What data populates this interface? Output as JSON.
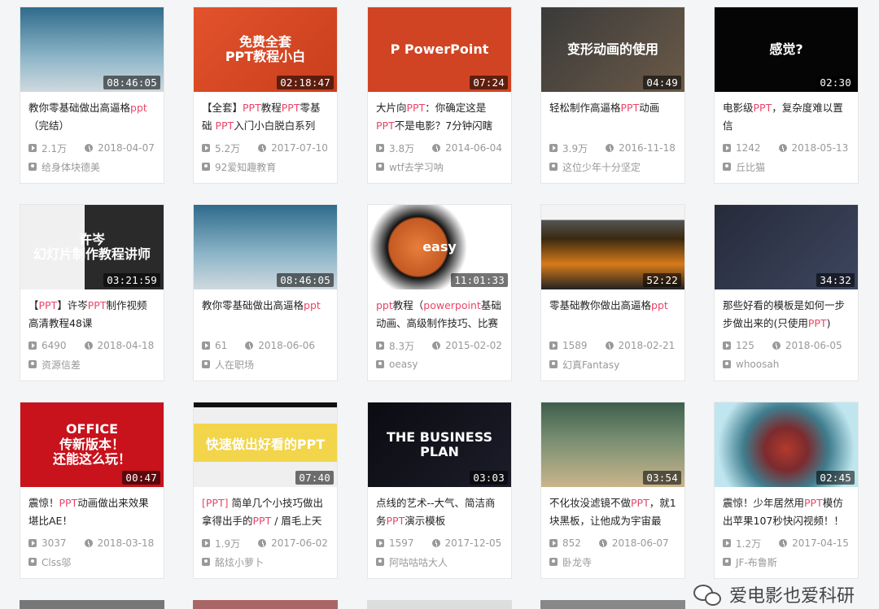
{
  "colors": {
    "highlight": "#e8466a",
    "meta": "#999999"
  },
  "icons": {
    "views": "play-icon",
    "date": "clock-icon",
    "author": "user-icon"
  },
  "videos": [
    {
      "thumb_text": "",
      "thumb_bg": "linear-gradient(180deg,#2f6b8c,#8fb7c9 60%,#cfd9de)",
      "duration": "08:46:05",
      "title": [
        {
          "t": "教你零基础做出高逼格"
        },
        {
          "t": "ppt",
          "hl": true
        },
        {
          "t": "（完结）"
        }
      ],
      "views": "2.1万",
      "date": "2018-04-07",
      "author": "给身体块德美"
    },
    {
      "thumb_text": "免费全套\nPPT教程小白",
      "thumb_bg": "linear-gradient(135deg,#e2522c,#c93e1c)",
      "duration": "02:18:47",
      "title": [
        {
          "t": "【全套】"
        },
        {
          "t": "PPT",
          "hl": true
        },
        {
          "t": "教程"
        },
        {
          "t": "PPT",
          "hl": true
        },
        {
          "t": "零基础 "
        },
        {
          "t": "PPT",
          "hl": true
        },
        {
          "t": "入门小白脱白系列"
        }
      ],
      "views": "5.2万",
      "date": "2017-07-10",
      "author": "92爱知趣教育"
    },
    {
      "thumb_text": "P  PowerPoint",
      "thumb_bg": "#d04423",
      "duration": "07:24",
      "title": [
        {
          "t": "大片向"
        },
        {
          "t": "PPT",
          "hl": true
        },
        {
          "t": "：你确定这是"
        },
        {
          "t": "PPT",
          "hl": true
        },
        {
          "t": "不是电影？7分钟闪瞎"
        }
      ],
      "views": "3.8万",
      "date": "2014-06-04",
      "author": "wtf去学习呐"
    },
    {
      "thumb_text": "变形动画的使用",
      "thumb_bg": "linear-gradient(135deg,#3a3a3a,#6b5a48)",
      "duration": "04:49",
      "title": [
        {
          "t": "轻松制作高逼格"
        },
        {
          "t": "PPT",
          "hl": true
        },
        {
          "t": "动画"
        }
      ],
      "views": "3.9万",
      "date": "2016-11-18",
      "author": "这位少年十分坚定"
    },
    {
      "thumb_text": "感觉?",
      "thumb_bg": "#050505",
      "duration": "02:30",
      "title": [
        {
          "t": "电影级"
        },
        {
          "t": "PPT",
          "hl": true
        },
        {
          "t": "，复杂度难以置信"
        }
      ],
      "views": "1242",
      "date": "2018-05-13",
      "author": "丘比猫"
    },
    {
      "thumb_text": "许岑\n幻灯片制作教程讲师",
      "thumb_bg": "linear-gradient(90deg,#f0f0f0 45%,#2a2a2a 45%)",
      "duration": "03:21:59",
      "title": [
        {
          "t": "【"
        },
        {
          "t": "PPT",
          "hl": true
        },
        {
          "t": "】许岑"
        },
        {
          "t": "PPT",
          "hl": true
        },
        {
          "t": "制作视频高清教程48课"
        }
      ],
      "views": "6490",
      "date": "2018-04-18",
      "author": "资源信差"
    },
    {
      "thumb_text": "",
      "thumb_bg": "linear-gradient(180deg,#2f6b8c,#8fb7c9 60%,#cfd9de)",
      "duration": "08:46:05",
      "title": [
        {
          "t": "教你零基础做出高逼格"
        },
        {
          "t": "ppt",
          "hl": true
        }
      ],
      "views": "61",
      "date": "2018-06-06",
      "author": "人在职场"
    },
    {
      "thumb_text": "easy",
      "thumb_bg": "radial-gradient(circle at 35% 50%,#e87e3c 0,#c55a23 28%,#111 30%,#fff 48%)",
      "duration": "11:01:33",
      "title": [
        {
          "t": "ppt",
          "hl": true
        },
        {
          "t": "教程（"
        },
        {
          "t": "powerpoint",
          "hl": true
        },
        {
          "t": "基础动画、高级制作技巧、比赛作"
        }
      ],
      "views": "8.3万",
      "date": "2015-02-02",
      "author": "oeasy"
    },
    {
      "thumb_text": "",
      "thumb_bg": "linear-gradient(180deg,#f3f3f3 18%,#555 18%,#3a2a10 40%,#d77a1a 70%,#222)",
      "duration": "52:22",
      "title": [
        {
          "t": "零基础教你做出高逼格"
        },
        {
          "t": "ppt",
          "hl": true
        }
      ],
      "views": "1589",
      "date": "2018-02-21",
      "author": "幻真Fantasy"
    },
    {
      "thumb_text": "",
      "thumb_bg": "linear-gradient(135deg,#262b3a,#3d4660)",
      "duration": "34:32",
      "title": [
        {
          "t": "那些好看的模板是如何一步步做出来的(只使用"
        },
        {
          "t": "PPT",
          "hl": true
        },
        {
          "t": ")"
        }
      ],
      "views": "125",
      "date": "2018-06-05",
      "author": "whoosah"
    },
    {
      "thumb_text": "OFFICE\n传新版本！\n还能这么玩！",
      "thumb_bg": "#c8121c",
      "duration": "00:47",
      "title": [
        {
          "t": "震惊！"
        },
        {
          "t": "PPT",
          "hl": true
        },
        {
          "t": "动画做出来效果堪比AE！"
        }
      ],
      "views": "3037",
      "date": "2018-03-18",
      "author": "Clss邬"
    },
    {
      "thumb_text": "快速做出好看的PPT",
      "thumb_bg": "linear-gradient(180deg,#111 6%,#efefef 6%,#efefef 25%,#f2d54a 25%,#f2d54a 70%,#efefef 70%)",
      "duration": "07:40",
      "title": [
        {
          "t": "[",
          "hl": true
        },
        {
          "t": "PPT",
          "hl": true
        },
        {
          "t": "]",
          "hl": true
        },
        {
          "t": " 简单几个小技巧做出拿得出手的"
        },
        {
          "t": "PPT",
          "hl": true
        },
        {
          "t": " / 眉毛上天"
        }
      ],
      "views": "1.9万",
      "date": "2017-06-02",
      "author": "酩炫小萝卜"
    },
    {
      "thumb_text": "THE BUSINESS  PLAN",
      "thumb_bg": "linear-gradient(135deg,#0b0b12,#1d1d2a)",
      "duration": "03:03",
      "title": [
        {
          "t": "点线的艺术--大气、简洁商务"
        },
        {
          "t": "PPT",
          "hl": true
        },
        {
          "t": "演示模板"
        }
      ],
      "views": "1597",
      "date": "2017-12-05",
      "author": "阿咕咕咕大人"
    },
    {
      "thumb_text": "",
      "thumb_bg": "linear-gradient(180deg,#3d5f4c,#7a8f72 45%,#c9b58c)",
      "duration": "03:54",
      "title": [
        {
          "t": "不化妆没滤镜不做"
        },
        {
          "t": "PPT",
          "hl": true
        },
        {
          "t": "，就1块黑板，让他成为宇宙最"
        }
      ],
      "views": "852",
      "date": "2018-06-07",
      "author": "卧龙寺"
    },
    {
      "thumb_text": "",
      "thumb_bg": "radial-gradient(circle at 50% 55%,#b23a2c 0,#7c2b2e 25%,#3f7d8e 50%,#bfe6ef 80%)",
      "duration": "02:45",
      "title": [
        {
          "t": "震惊！少年居然用"
        },
        {
          "t": "PPT",
          "hl": true
        },
        {
          "t": "模仿出苹果107秒快闪视频！！"
        }
      ],
      "views": "1.2万",
      "date": "2017-04-15",
      "author": "JF-布鲁斯"
    }
  ],
  "watermark": "爱电影也爱科研"
}
